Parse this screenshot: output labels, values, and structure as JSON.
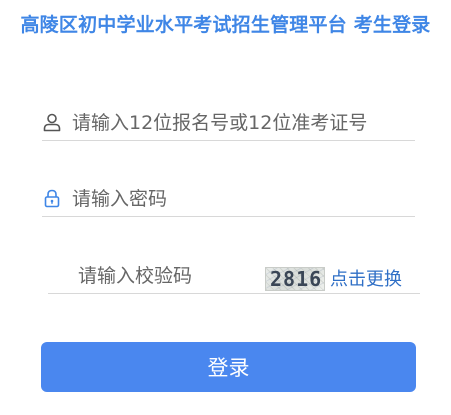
{
  "page": {
    "title": "高陵区初中学业水平考试招生管理平台 考生登录"
  },
  "form": {
    "account_placeholder": "请输入12位报名号或12位准考证号",
    "password_placeholder": "请输入密码",
    "captcha_placeholder": "请输入校验码",
    "captcha_code": "2816",
    "refresh_label": "点击更换",
    "submit_label": "登录"
  },
  "icons": {
    "account": "user-icon",
    "password": "lock-icon"
  },
  "colors": {
    "accent": "#3f86e6",
    "button": "#4a87ef",
    "link": "#2f6fc6"
  }
}
